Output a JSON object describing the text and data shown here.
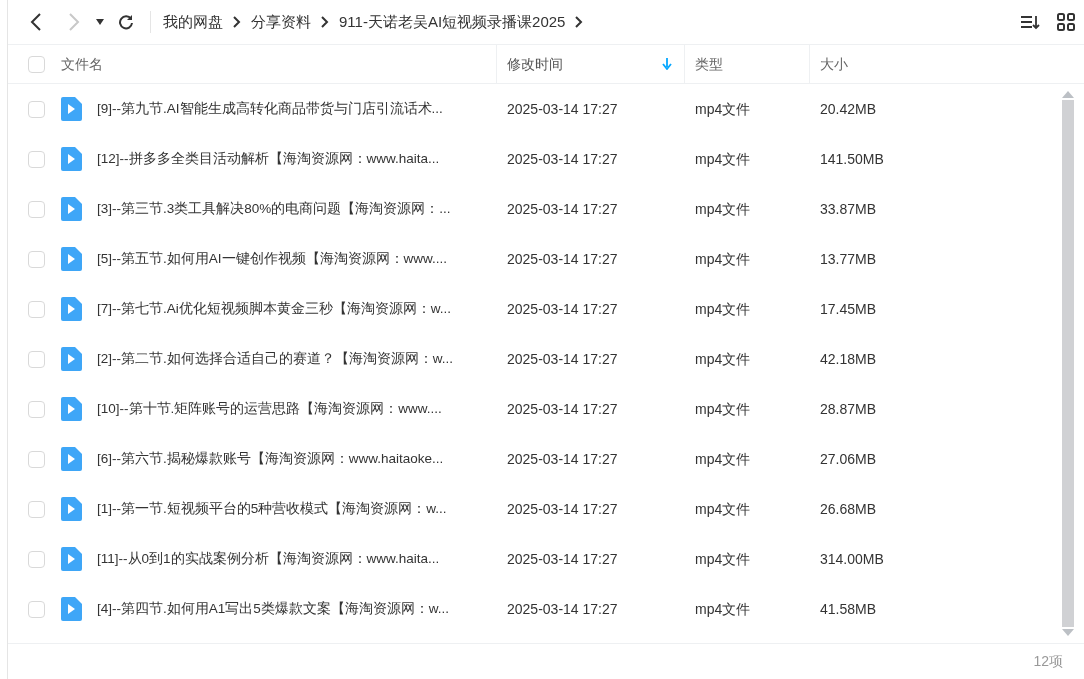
{
  "toolbar": {
    "back_enabled": true,
    "forward_enabled": false
  },
  "breadcrumb": [
    "我的网盘",
    "分享资料",
    "911-天诺老吴AI短视频录播课2025"
  ],
  "table": {
    "columns": [
      {
        "label": "文件名",
        "sorted": false
      },
      {
        "label": "修改时间",
        "sorted": true
      },
      {
        "label": "类型",
        "sorted": false
      },
      {
        "label": "大小",
        "sorted": false
      }
    ],
    "all_checked": false,
    "rows": [
      {
        "checked": false,
        "name": "[9]--第九节.AI智能生成高转化商品带货与门店引流话术...",
        "time": "2025-03-14 17:27",
        "type": "mp4文件",
        "size": "20.42MB"
      },
      {
        "checked": false,
        "name": "[12]--拼多多全类目活动解析【海淘资源网：www.haita...",
        "time": "2025-03-14 17:27",
        "type": "mp4文件",
        "size": "141.50MB"
      },
      {
        "checked": false,
        "name": "[3]--第三节.3类工具解决80%的电商问题【海淘资源网：...",
        "time": "2025-03-14 17:27",
        "type": "mp4文件",
        "size": "33.87MB"
      },
      {
        "checked": false,
        "name": "[5]--第五节.如何用AI一键创作视频【海淘资源网：www....",
        "time": "2025-03-14 17:27",
        "type": "mp4文件",
        "size": "13.77MB"
      },
      {
        "checked": false,
        "name": "[7]--第七节.Ai优化短视频脚本黄金三秒【海淘资源网：w...",
        "time": "2025-03-14 17:27",
        "type": "mp4文件",
        "size": "17.45MB"
      },
      {
        "checked": false,
        "name": "[2]--第二节.如何选择合适自己的赛道？【海淘资源网：w...",
        "time": "2025-03-14 17:27",
        "type": "mp4文件",
        "size": "42.18MB"
      },
      {
        "checked": false,
        "name": "[10]--第十节.矩阵账号的运营思路【海淘资源网：www....",
        "time": "2025-03-14 17:27",
        "type": "mp4文件",
        "size": "28.87MB"
      },
      {
        "checked": false,
        "name": "[6]--第六节.揭秘爆款账号【海淘资源网：www.haitaoke...",
        "time": "2025-03-14 17:27",
        "type": "mp4文件",
        "size": "27.06MB"
      },
      {
        "checked": false,
        "name": "[1]--第一节.短视频平台的5种营收模式【海淘资源网：w...",
        "time": "2025-03-14 17:27",
        "type": "mp4文件",
        "size": "26.68MB"
      },
      {
        "checked": false,
        "name": "[11]--从0到1的实战案例分析【海淘资源网：www.haita...",
        "time": "2025-03-14 17:27",
        "type": "mp4文件",
        "size": "314.00MB"
      },
      {
        "checked": false,
        "name": "[4]--第四节.如何用A1写出5类爆款文案【海淘资源网：w...",
        "time": "2025-03-14 17:27",
        "type": "mp4文件",
        "size": "41.58MB"
      }
    ]
  },
  "status_bar": {
    "count": "12项"
  }
}
